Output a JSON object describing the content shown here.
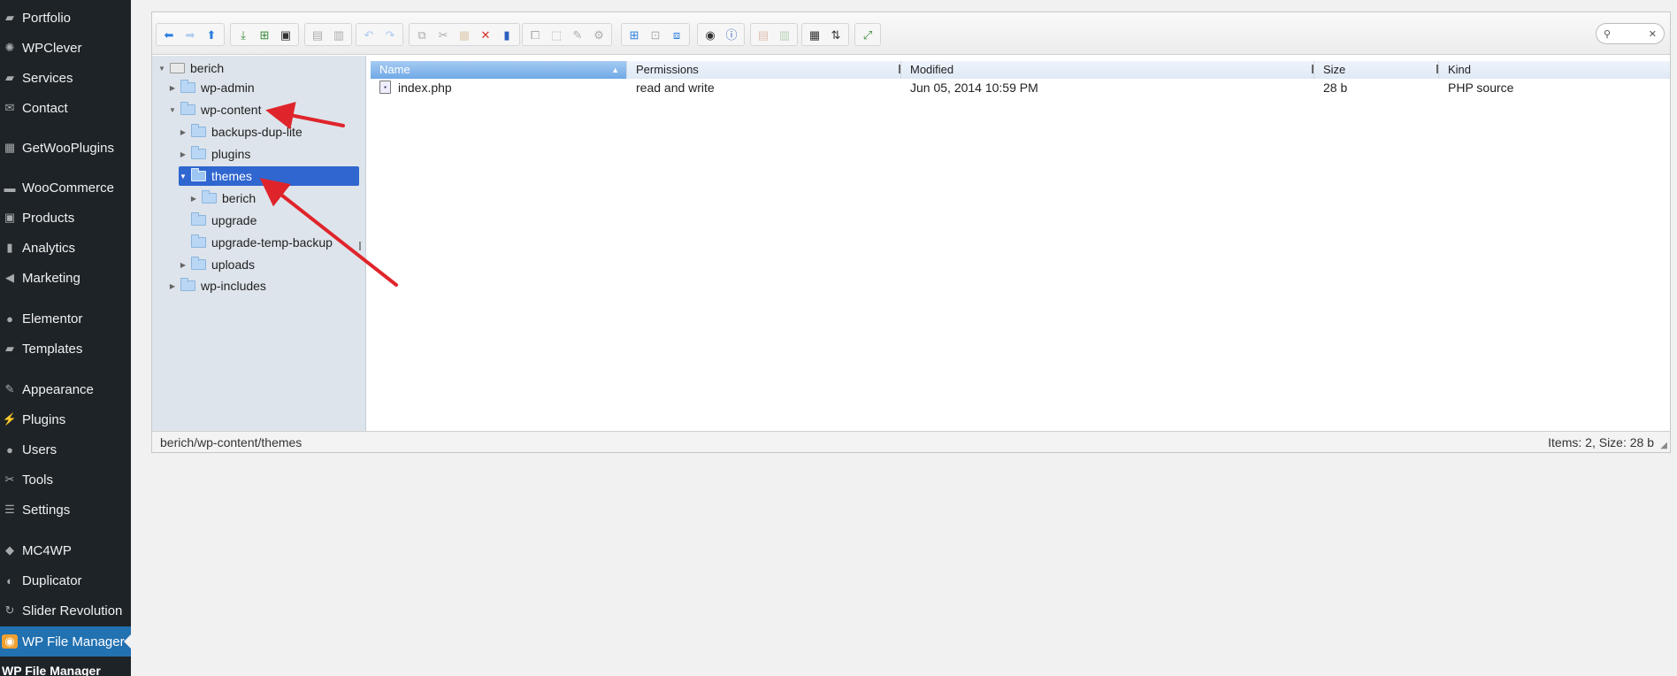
{
  "sidebar": {
    "items": [
      {
        "label": "Portfolio",
        "icon": "folder-icon"
      },
      {
        "label": "WPClever",
        "icon": "lightbulb-icon"
      },
      {
        "label": "Services",
        "icon": "folder-icon"
      },
      {
        "label": "Contact",
        "icon": "mail-icon"
      },
      {
        "label": "GetWooPlugins",
        "icon": "grid-icon"
      },
      {
        "label": "WooCommerce",
        "icon": "woo-icon"
      },
      {
        "label": "Products",
        "icon": "box-icon"
      },
      {
        "label": "Analytics",
        "icon": "bar-chart-icon"
      },
      {
        "label": "Marketing",
        "icon": "megaphone-icon"
      },
      {
        "label": "Elementor",
        "icon": "elementor-icon"
      },
      {
        "label": "Templates",
        "icon": "folder-icon"
      },
      {
        "label": "Appearance",
        "icon": "paintbrush-icon"
      },
      {
        "label": "Plugins",
        "icon": "plug-icon"
      },
      {
        "label": "Users",
        "icon": "user-icon"
      },
      {
        "label": "Tools",
        "icon": "wrench-icon"
      },
      {
        "label": "Settings",
        "icon": "sliders-icon"
      },
      {
        "label": "MC4WP",
        "icon": "mc4wp-icon"
      },
      {
        "label": "Duplicator",
        "icon": "duplicator-icon"
      },
      {
        "label": "Slider Revolution",
        "icon": "refresh-icon"
      },
      {
        "label": "WP File Manager",
        "icon": "file-manager-icon",
        "active": true
      }
    ],
    "submenu_label": "WP File Manager"
  },
  "toolbar": {
    "search_placeholder": ""
  },
  "tree": {
    "root": "berich",
    "nodes": [
      {
        "label": "wp-admin"
      },
      {
        "label": "wp-content"
      },
      {
        "label": "backups-dup-lite"
      },
      {
        "label": "plugins"
      },
      {
        "label": "themes"
      },
      {
        "label": "berich"
      },
      {
        "label": "upgrade"
      },
      {
        "label": "upgrade-temp-backup"
      },
      {
        "label": "uploads"
      },
      {
        "label": "wp-includes"
      }
    ]
  },
  "list": {
    "columns": [
      "Name",
      "Permissions",
      "Modified",
      "Size",
      "Kind"
    ],
    "rows": [
      {
        "name": "index.php",
        "permissions": "read and write",
        "modified": "Jun 05, 2014 10:59 PM",
        "size": "28 b",
        "kind": "PHP source"
      }
    ]
  },
  "status": {
    "path": "berich/wp-content/themes",
    "info": "Items: 2, Size: 28 b"
  },
  "annotation_color": "#e0242b"
}
